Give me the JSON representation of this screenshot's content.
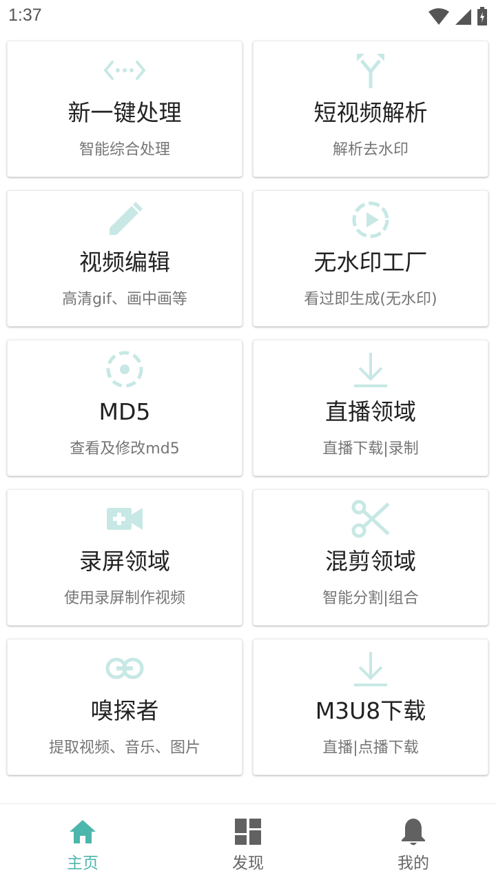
{
  "status_bar": {
    "time": "1:37"
  },
  "colors": {
    "icon_tint": "#c7e8e5",
    "accent": "#4db6ac",
    "nav_inactive": "#616161"
  },
  "cards": [
    {
      "title": "新一键处理",
      "subtitle": "智能综合处理",
      "icon": "code-arrows-icon"
    },
    {
      "title": "短视频解析",
      "subtitle": "解析去水印",
      "icon": "merge-arrows-icon"
    },
    {
      "title": "视频编辑",
      "subtitle": "高清gif、画中画等",
      "icon": "pencil-icon"
    },
    {
      "title": "无水印工厂",
      "subtitle": "看过即生成(无水印)",
      "icon": "play-circle-dashed-icon"
    },
    {
      "title": "MD5",
      "subtitle": "查看及修改md5",
      "icon": "dashed-circle-dot-icon"
    },
    {
      "title": "直播领域",
      "subtitle": "直播下载|录制",
      "icon": "download-icon"
    },
    {
      "title": "录屏领域",
      "subtitle": "使用录屏制作视频",
      "icon": "video-add-icon"
    },
    {
      "title": "混剪领域",
      "subtitle": "智能分割|组合",
      "icon": "scissors-icon"
    },
    {
      "title": "嗅探者",
      "subtitle": "提取视频、音乐、图片",
      "icon": "link-icon"
    },
    {
      "title": "M3U8下载",
      "subtitle": "直播|点播下载",
      "icon": "download-icon"
    }
  ],
  "bottom_nav": [
    {
      "label": "主页",
      "icon": "home-icon",
      "active": true
    },
    {
      "label": "发现",
      "icon": "dashboard-icon",
      "active": false
    },
    {
      "label": "我的",
      "icon": "bell-icon",
      "active": false
    }
  ]
}
